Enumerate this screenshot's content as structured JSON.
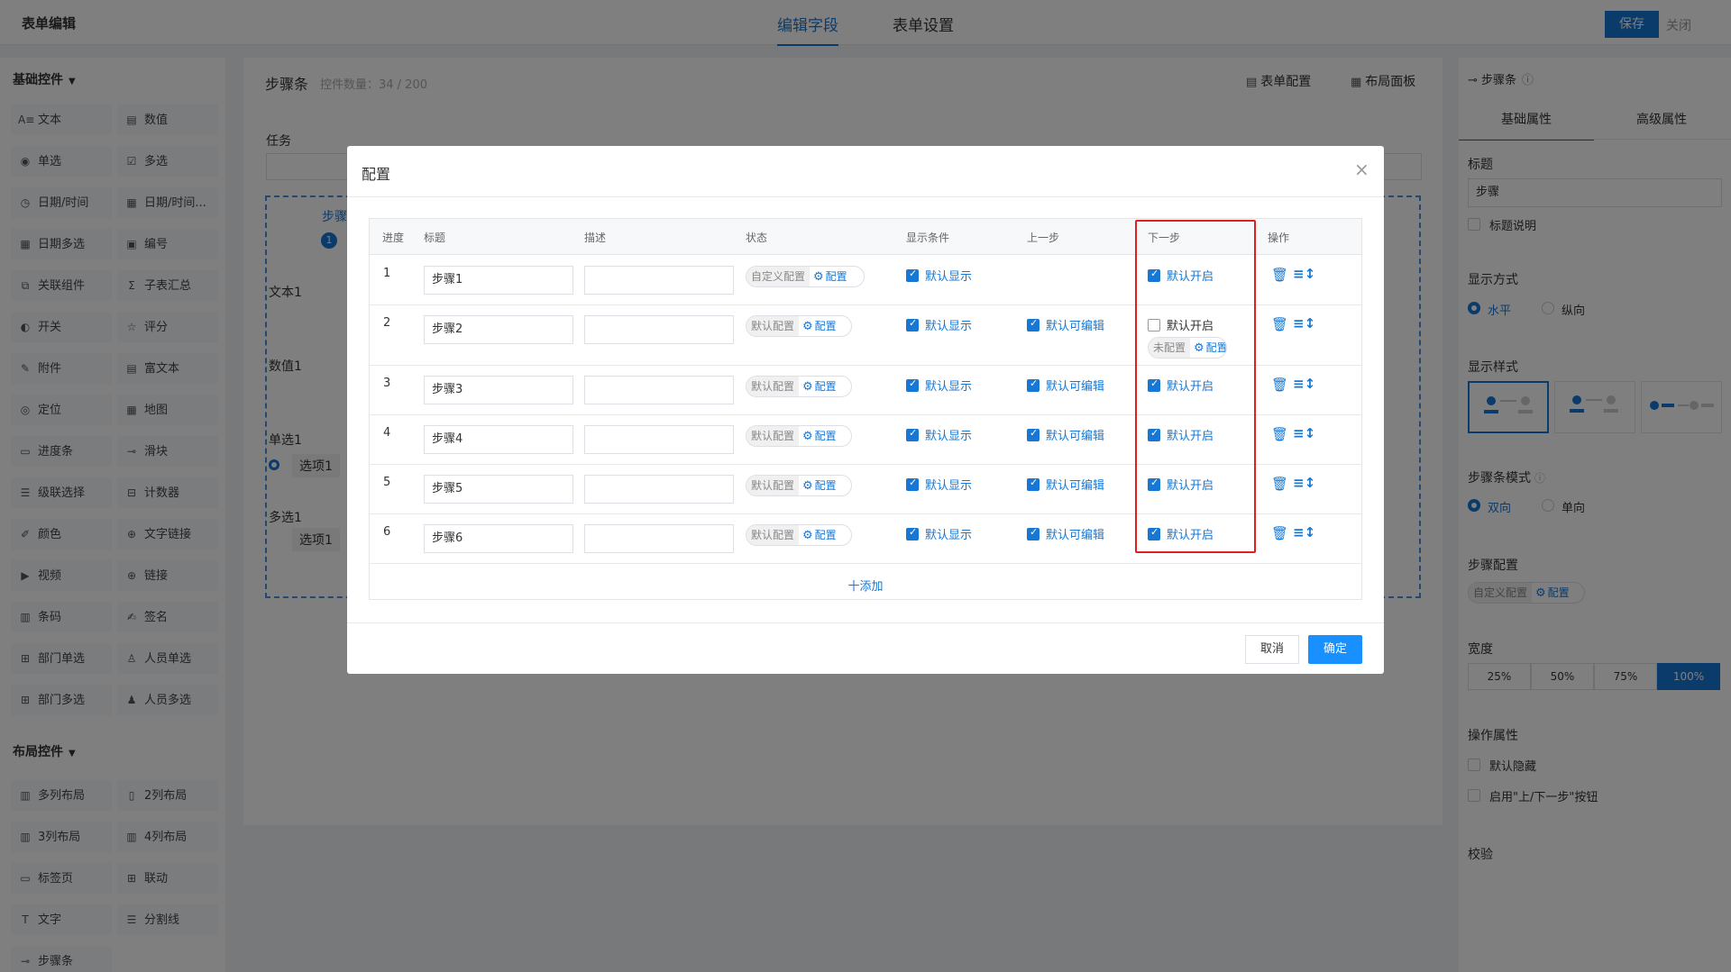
{
  "app": {
    "title": "表单编辑",
    "tabs": [
      "编辑字段",
      "表单设置"
    ],
    "save_label": "保存",
    "close_label": "关闭"
  },
  "left_panel": {
    "basic_title": "基础控件",
    "basic_items": [
      {
        "label": "文本",
        "icon": "A≡"
      },
      {
        "label": "数值",
        "icon": "▤"
      },
      {
        "label": "单选",
        "icon": "◉"
      },
      {
        "label": "多选",
        "icon": "☑"
      },
      {
        "label": "日期/时间",
        "icon": "◷"
      },
      {
        "label": "日期/时间...",
        "icon": "▦"
      },
      {
        "label": "日期多选",
        "icon": "▦"
      },
      {
        "label": "编号",
        "icon": "▣"
      },
      {
        "label": "关联组件",
        "icon": "⧉"
      },
      {
        "label": "子表汇总",
        "icon": "Σ"
      },
      {
        "label": "开关",
        "icon": "◐"
      },
      {
        "label": "评分",
        "icon": "☆"
      },
      {
        "label": "附件",
        "icon": "✎"
      },
      {
        "label": "富文本",
        "icon": "▤"
      },
      {
        "label": "定位",
        "icon": "◎"
      },
      {
        "label": "地图",
        "icon": "▦"
      },
      {
        "label": "进度条",
        "icon": "▭"
      },
      {
        "label": "滑块",
        "icon": "⊸"
      },
      {
        "label": "级联选择",
        "icon": "☰"
      },
      {
        "label": "计数器",
        "icon": "⊟"
      },
      {
        "label": "颜色",
        "icon": "✐"
      },
      {
        "label": "文字链接",
        "icon": "⊕"
      },
      {
        "label": "视频",
        "icon": "▶"
      },
      {
        "label": "链接",
        "icon": "⊕"
      },
      {
        "label": "条码",
        "icon": "▥"
      },
      {
        "label": "签名",
        "icon": "✍"
      },
      {
        "label": "部门单选",
        "icon": "⊞"
      },
      {
        "label": "人员单选",
        "icon": "♙"
      },
      {
        "label": "部门多选",
        "icon": "⊞"
      },
      {
        "label": "人员多选",
        "icon": "♟"
      }
    ],
    "layout_title": "布局控件",
    "layout_items": [
      {
        "label": "多列布局",
        "icon": "▥"
      },
      {
        "label": "2列布局",
        "icon": "▯"
      },
      {
        "label": "3列布局",
        "icon": "▥"
      },
      {
        "label": "4列布局",
        "icon": "▥"
      },
      {
        "label": "标签页",
        "icon": "▭"
      },
      {
        "label": "联动",
        "icon": "⊞"
      },
      {
        "label": "文字",
        "icon": "T"
      },
      {
        "label": "分割线",
        "icon": "☰"
      },
      {
        "label": "步骤条",
        "icon": "⊸"
      }
    ]
  },
  "canvas": {
    "title": "步骤条",
    "count": "控件数量：34 / 200",
    "form_config": "表单配置",
    "layout_panel": "布局面板",
    "labels": {
      "task": "任务",
      "step": "步骤",
      "step_num": "1",
      "text1": "文本1",
      "number1": "数值1",
      "single1": "单选1",
      "option_a": "选项1",
      "multi1": "多选1",
      "option_b": "选项1"
    }
  },
  "modal": {
    "title": "配置",
    "columns": [
      "进度",
      "标题",
      "描述",
      "状态",
      "显示条件",
      "上一步",
      "下一步",
      "操作"
    ],
    "rows": [
      {
        "num": "1",
        "title": "步骤1",
        "status_text": "自定义配置",
        "status_btn": "配置",
        "show": "默认显示",
        "prev": "",
        "prev_checked": false,
        "next": "默认开启",
        "next_checked": true,
        "next_pill": "",
        "next_pill_btn": ""
      },
      {
        "num": "2",
        "title": "步骤2",
        "status_text": "默认配置",
        "status_btn": "配置",
        "show": "默认显示",
        "prev": "默认可编辑",
        "prev_checked": true,
        "next": "默认开启",
        "next_checked": false,
        "next_pill": "未配置",
        "next_pill_btn": "配置"
      },
      {
        "num": "3",
        "title": "步骤3",
        "status_text": "默认配置",
        "status_btn": "配置",
        "show": "默认显示",
        "prev": "默认可编辑",
        "prev_checked": true,
        "next": "默认开启",
        "next_checked": true,
        "next_pill": "",
        "next_pill_btn": ""
      },
      {
        "num": "4",
        "title": "步骤4",
        "status_text": "默认配置",
        "status_btn": "配置",
        "show": "默认显示",
        "prev": "默认可编辑",
        "prev_checked": true,
        "next": "默认开启",
        "next_checked": true,
        "next_pill": "",
        "next_pill_btn": ""
      },
      {
        "num": "5",
        "title": "步骤5",
        "status_text": "默认配置",
        "status_btn": "配置",
        "show": "默认显示",
        "prev": "默认可编辑",
        "prev_checked": true,
        "next": "默认开启",
        "next_checked": true,
        "next_pill": "",
        "next_pill_btn": ""
      },
      {
        "num": "6",
        "title": "步骤6",
        "status_text": "默认配置",
        "status_btn": "配置",
        "show": "默认显示",
        "prev": "默认可编辑",
        "prev_checked": true,
        "next": "默认开启",
        "next_checked": true,
        "next_pill": "",
        "next_pill_btn": ""
      }
    ],
    "add_label": "十添加",
    "cancel_label": "取消",
    "ok_label": "确定",
    "highlight_color": "#e02020"
  },
  "right_panel": {
    "header": "步骤条",
    "tabs": [
      "基础属性",
      "高级属性"
    ],
    "title_label": "标题",
    "title_value": "步骤",
    "title_desc": "标题说明",
    "display_mode_label": "显示方式",
    "display_modes": [
      "水平",
      "纵向"
    ],
    "display_style_label": "显示样式",
    "step_mode_label": "步骤条模式",
    "step_modes": [
      "双向",
      "单向"
    ],
    "step_config_label": "步骤配置",
    "step_config_text": "自定义配置",
    "step_config_btn": "配置",
    "width_label": "宽度",
    "widths": [
      "25%",
      "50%",
      "75%",
      "100%"
    ],
    "op_label": "操作属性",
    "op_hide": "默认隐藏",
    "op_enable": "启用\"上/下一步\"按钮",
    "validate_label": "校验"
  },
  "colors": {
    "primary": "#1677d4",
    "highlight": "#e02020"
  }
}
